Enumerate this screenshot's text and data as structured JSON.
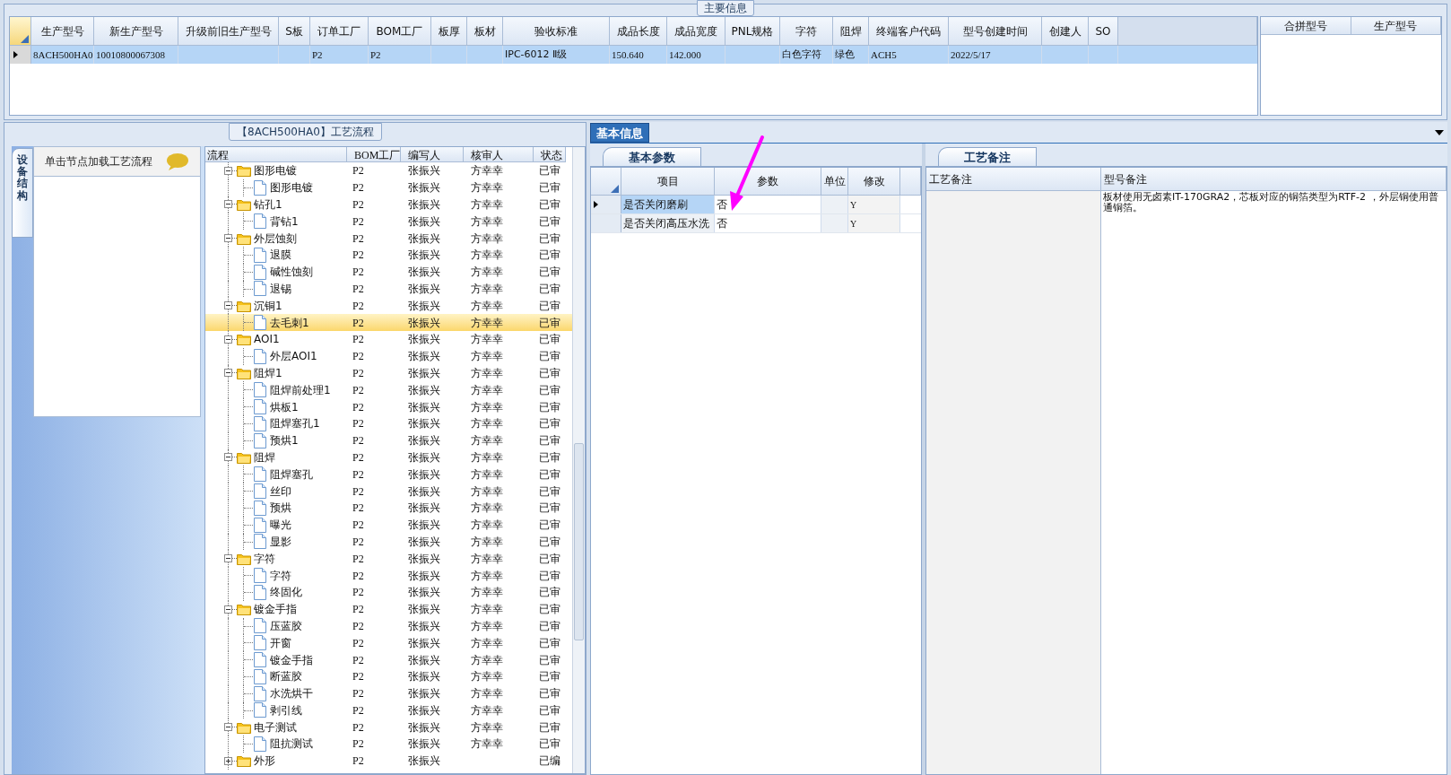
{
  "main_info": {
    "title": "主要信息",
    "columns": [
      "生产型号",
      "新生产型号",
      "升级前旧生产型号",
      "S板",
      "订单工厂",
      "BOM工厂",
      "板厚",
      "板材",
      "验收标准",
      "成品长度",
      "成品宽度",
      "PNL规格",
      "字符",
      "阻焊",
      "终端客户代码",
      "型号创建时间",
      "创建人",
      "SO"
    ],
    "rows": [
      {
        "selected": true,
        "cells": [
          "8ACH500HA0",
          "10010800067308",
          "",
          "",
          "P2",
          "P2",
          "",
          "",
          "IPC-6012 Ⅱ级",
          "150.640",
          "142.000",
          "",
          "白色字符",
          "绿色",
          "ACH5",
          "2022/5/17",
          "",
          ""
        ]
      }
    ],
    "merge_table": {
      "columns": [
        "合拼型号",
        "生产型号"
      ]
    }
  },
  "left_panel": {
    "side_tab": "设备结构",
    "hint": "单击节点加载工艺流程"
  },
  "process_flow": {
    "title": "【8ACH500HA0】工艺流程",
    "columns": [
      "流程",
      "BOM工厂",
      "编写人",
      "核审人",
      "状态"
    ],
    "nodes": [
      {
        "name": "图形电镀",
        "bom": "P2",
        "writer": "张振兴",
        "reviewer": "方幸幸",
        "status": "已审",
        "selected": false,
        "children": [
          {
            "name": "图形电镀",
            "bom": "P2",
            "writer": "张振兴",
            "reviewer": "方幸幸",
            "status": "已审",
            "selected": false
          }
        ]
      },
      {
        "name": "钻孔1",
        "bom": "P2",
        "writer": "张振兴",
        "reviewer": "方幸幸",
        "status": "已审",
        "selected": false,
        "children": [
          {
            "name": "背钻1",
            "bom": "P2",
            "writer": "张振兴",
            "reviewer": "方幸幸",
            "status": "已审",
            "selected": false
          }
        ]
      },
      {
        "name": "外层蚀刻",
        "bom": "P2",
        "writer": "张振兴",
        "reviewer": "方幸幸",
        "status": "已审",
        "selected": false,
        "children": [
          {
            "name": "退膜",
            "bom": "P2",
            "writer": "张振兴",
            "reviewer": "方幸幸",
            "status": "已审",
            "selected": false
          },
          {
            "name": "碱性蚀刻",
            "bom": "P2",
            "writer": "张振兴",
            "reviewer": "方幸幸",
            "status": "已审",
            "selected": false
          },
          {
            "name": "退锡",
            "bom": "P2",
            "writer": "张振兴",
            "reviewer": "方幸幸",
            "status": "已审",
            "selected": false
          }
        ]
      },
      {
        "name": "沉铜1",
        "bom": "P2",
        "writer": "张振兴",
        "reviewer": "方幸幸",
        "status": "已审",
        "selected": false,
        "children": [
          {
            "name": "去毛刺1",
            "bom": "P2",
            "writer": "张振兴",
            "reviewer": "方幸幸",
            "status": "已审",
            "selected": true
          }
        ]
      },
      {
        "name": "AOI1",
        "bom": "P2",
        "writer": "张振兴",
        "reviewer": "方幸幸",
        "status": "已审",
        "selected": false,
        "children": [
          {
            "name": "外层AOI1",
            "bom": "P2",
            "writer": "张振兴",
            "reviewer": "方幸幸",
            "status": "已审",
            "selected": false
          }
        ]
      },
      {
        "name": "阻焊1",
        "bom": "P2",
        "writer": "张振兴",
        "reviewer": "方幸幸",
        "status": "已审",
        "selected": false,
        "children": [
          {
            "name": "阻焊前处理1",
            "bom": "P2",
            "writer": "张振兴",
            "reviewer": "方幸幸",
            "status": "已审",
            "selected": false
          },
          {
            "name": "烘板1",
            "bom": "P2",
            "writer": "张振兴",
            "reviewer": "方幸幸",
            "status": "已审",
            "selected": false
          },
          {
            "name": "阻焊塞孔1",
            "bom": "P2",
            "writer": "张振兴",
            "reviewer": "方幸幸",
            "status": "已审",
            "selected": false
          },
          {
            "name": "预烘1",
            "bom": "P2",
            "writer": "张振兴",
            "reviewer": "方幸幸",
            "status": "已审",
            "selected": false
          }
        ]
      },
      {
        "name": "阻焊",
        "bom": "P2",
        "writer": "张振兴",
        "reviewer": "方幸幸",
        "status": "已审",
        "selected": false,
        "children": [
          {
            "name": "阻焊塞孔",
            "bom": "P2",
            "writer": "张振兴",
            "reviewer": "方幸幸",
            "status": "已审",
            "selected": false
          },
          {
            "name": "丝印",
            "bom": "P2",
            "writer": "张振兴",
            "reviewer": "方幸幸",
            "status": "已审",
            "selected": false
          },
          {
            "name": "预烘",
            "bom": "P2",
            "writer": "张振兴",
            "reviewer": "方幸幸",
            "status": "已审",
            "selected": false
          },
          {
            "name": "曝光",
            "bom": "P2",
            "writer": "张振兴",
            "reviewer": "方幸幸",
            "status": "已审",
            "selected": false
          },
          {
            "name": "显影",
            "bom": "P2",
            "writer": "张振兴",
            "reviewer": "方幸幸",
            "status": "已审",
            "selected": false
          }
        ]
      },
      {
        "name": "字符",
        "bom": "P2",
        "writer": "张振兴",
        "reviewer": "方幸幸",
        "status": "已审",
        "selected": false,
        "children": [
          {
            "name": "字符",
            "bom": "P2",
            "writer": "张振兴",
            "reviewer": "方幸幸",
            "status": "已审",
            "selected": false
          },
          {
            "name": "终固化",
            "bom": "P2",
            "writer": "张振兴",
            "reviewer": "方幸幸",
            "status": "已审",
            "selected": false
          }
        ]
      },
      {
        "name": "镀金手指",
        "bom": "P2",
        "writer": "张振兴",
        "reviewer": "方幸幸",
        "status": "已审",
        "selected": false,
        "children": [
          {
            "name": "压蓝胶",
            "bom": "P2",
            "writer": "张振兴",
            "reviewer": "方幸幸",
            "status": "已审",
            "selected": false
          },
          {
            "name": "开窗",
            "bom": "P2",
            "writer": "张振兴",
            "reviewer": "方幸幸",
            "status": "已审",
            "selected": false
          },
          {
            "name": "镀金手指",
            "bom": "P2",
            "writer": "张振兴",
            "reviewer": "方幸幸",
            "status": "已审",
            "selected": false
          },
          {
            "name": "断蓝胶",
            "bom": "P2",
            "writer": "张振兴",
            "reviewer": "方幸幸",
            "status": "已审",
            "selected": false
          },
          {
            "name": "水洗烘干",
            "bom": "P2",
            "writer": "张振兴",
            "reviewer": "方幸幸",
            "status": "已审",
            "selected": false
          },
          {
            "name": "剥引线",
            "bom": "P2",
            "writer": "张振兴",
            "reviewer": "方幸幸",
            "status": "已审",
            "selected": false
          }
        ]
      },
      {
        "name": "电子测试",
        "bom": "P2",
        "writer": "张振兴",
        "reviewer": "方幸幸",
        "status": "已审",
        "selected": false,
        "children": [
          {
            "name": "阻抗测试",
            "bom": "P2",
            "writer": "张振兴",
            "reviewer": "方幸幸",
            "status": "已审",
            "selected": false
          }
        ]
      },
      {
        "name": "外形",
        "bom": "P2",
        "writer": "张振兴",
        "status": "已编",
        "selected": false
      }
    ]
  },
  "detail": {
    "tabs": [
      {
        "label": "基本信息",
        "selected": true
      }
    ],
    "params": {
      "tabs": [
        {
          "label": "基本参数",
          "selected": true
        }
      ],
      "columns": [
        "项目",
        "参数",
        "单位",
        "修改"
      ],
      "rows": [
        {
          "current": true,
          "item": "是否关闭磨刷",
          "value": "否",
          "modify": "Y"
        },
        {
          "current": false,
          "item": "是否关闭高压水洗",
          "value": "否",
          "modify": "Y"
        }
      ]
    },
    "notes": {
      "tabs": [
        {
          "label": "工艺备注",
          "selected": true
        }
      ],
      "columns": [
        "工艺备注",
        "型号备注"
      ],
      "model_note": "板材使用无卤素IT-170GRA2，芯板对应的铜箔类型为RTF-2 ，外层铜使用普通铜箔。"
    }
  }
}
